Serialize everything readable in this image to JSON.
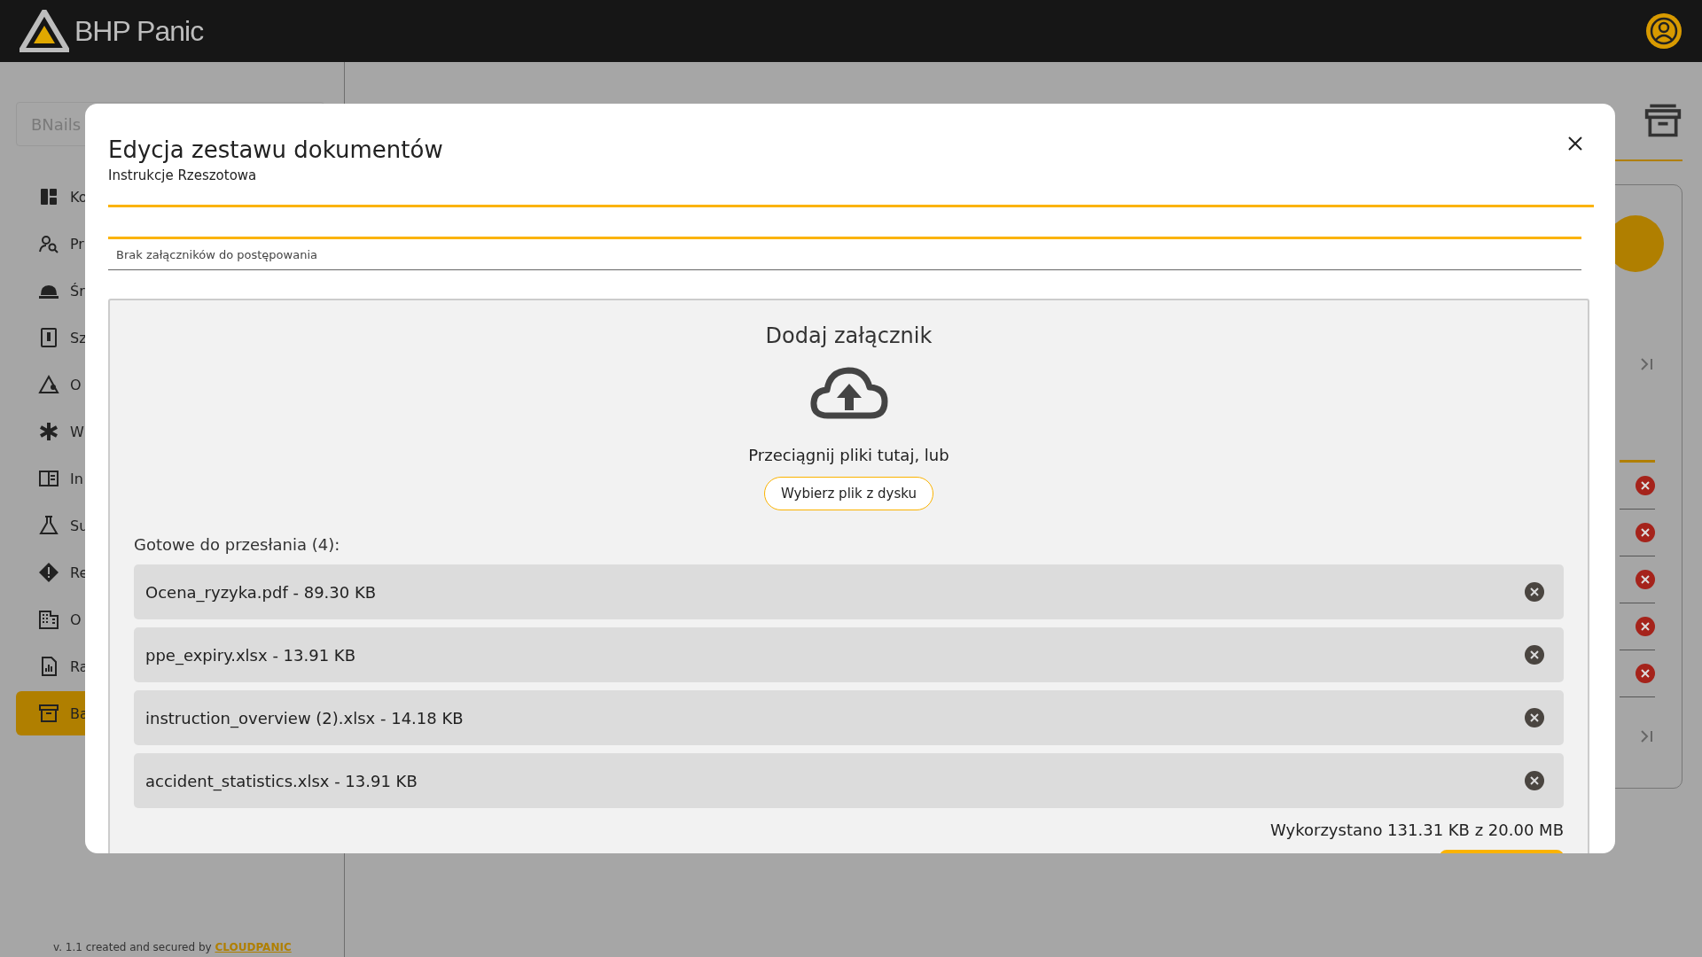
{
  "header": {
    "logo_text": "BHP Panic"
  },
  "sidebar": {
    "search": {
      "value": "BNails"
    },
    "items": [
      {
        "label": "Ko",
        "selected": false
      },
      {
        "label": "Pr",
        "selected": false
      },
      {
        "label": "Śr",
        "selected": false
      },
      {
        "label": "Sz",
        "selected": false
      },
      {
        "label": "O",
        "selected": false
      },
      {
        "label": "W",
        "selected": false
      },
      {
        "label": "In",
        "selected": false
      },
      {
        "label": "Su",
        "selected": false
      },
      {
        "label": "Re",
        "selected": false
      },
      {
        "label": "O",
        "selected": false
      },
      {
        "label": "Ra",
        "selected": false
      },
      {
        "label": "Ba",
        "selected": true
      }
    ],
    "footer": {
      "text": "v. 1.1 created and secured by",
      "link": "CLOUDPANIC"
    }
  },
  "modal": {
    "title": "Edycja zestawu dokumentów",
    "subtitle": "Instrukcje Rzeszotowa",
    "attachments_field": "Brak załączników do postępowania",
    "upload": {
      "heading": "Dodaj załącznik",
      "hint": "Przeciągnij pliki tutaj, lub",
      "choose_button": "Wybierz plik z dysku",
      "queue_label": "Gotowe do przesłania (4):",
      "files": [
        {
          "name": "Ocena_ryzyka.pdf - 89.30 KB"
        },
        {
          "name": "ppe_expiry.xlsx - 13.91 KB"
        },
        {
          "name": "instruction_overview (2).xlsx - 14.18 KB"
        },
        {
          "name": "accident_statistics.xlsx - 13.91 KB"
        }
      ],
      "usage": "Wykorzystano 131.31 KB z 20.00 MB"
    }
  }
}
